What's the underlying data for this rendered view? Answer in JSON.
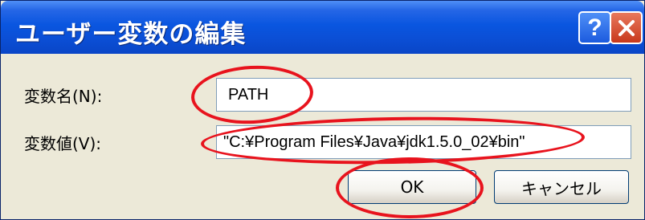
{
  "window": {
    "title": "ユーザー変数の編集",
    "help_symbol": "?",
    "close_icon": "close-icon"
  },
  "form": {
    "name_label": "変数名(N):",
    "name_value": "PATH",
    "value_label": "変数値(V):",
    "value_value": "\"C:¥Program Files¥Java¥jdk1.5.0_02¥bin\""
  },
  "buttons": {
    "ok_label": "OK",
    "cancel_label": "キャンセル"
  },
  "annotations": {
    "color": "#e8131d"
  },
  "colors": {
    "titlebar": "#0a56e0",
    "dialog_background": "#ece9d8",
    "close_button": "#c8391c"
  }
}
